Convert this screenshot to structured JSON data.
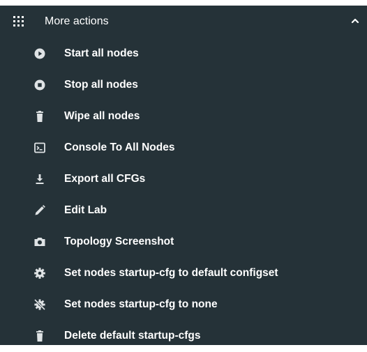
{
  "header": {
    "title": "More actions",
    "menu_icon": "apps-grid-icon",
    "toggle_icon": "chevron-up-icon"
  },
  "items": [
    {
      "label": "Start all nodes",
      "icon": "play-circle-icon"
    },
    {
      "label": "Stop all nodes",
      "icon": "stop-circle-icon"
    },
    {
      "label": "Wipe all nodes",
      "icon": "trash-icon"
    },
    {
      "label": "Console To All Nodes",
      "icon": "terminal-icon"
    },
    {
      "label": "Export all CFGs",
      "icon": "download-icon"
    },
    {
      "label": "Edit Lab",
      "icon": "pencil-icon"
    },
    {
      "label": "Topology Screenshot",
      "icon": "camera-icon"
    },
    {
      "label": "Set nodes startup-cfg to default configset",
      "icon": "gear-icon"
    },
    {
      "label": "Set nodes startup-cfg to none",
      "icon": "gear-off-icon"
    },
    {
      "label": "Delete default startup-cfgs",
      "icon": "trash-icon"
    }
  ],
  "colors": {
    "panel_background": "#253238",
    "text": "#ffffff",
    "icon": "#dfe3e5"
  }
}
